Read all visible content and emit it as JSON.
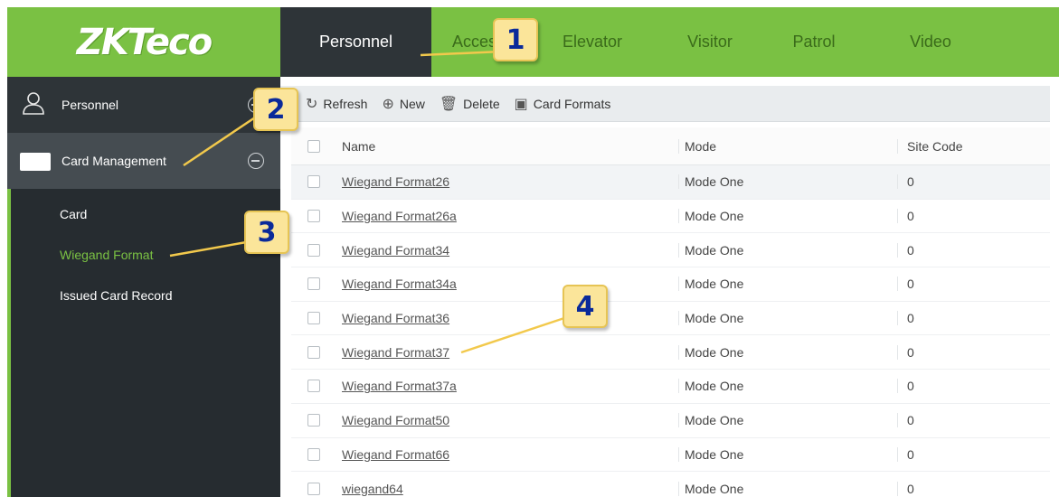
{
  "header": {
    "logo_text": "ZKTeco",
    "tabs": [
      {
        "label": "Personnel",
        "active": true
      },
      {
        "label": "Access"
      },
      {
        "label": "Elevator"
      },
      {
        "label": "Visitor"
      },
      {
        "label": "Patrol"
      },
      {
        "label": "Video"
      }
    ]
  },
  "sidebar": {
    "personnel_label": "Personnel",
    "card_management_label": "Card Management",
    "submenu": [
      {
        "label": "Card"
      },
      {
        "label": "Wiegand Format",
        "active": true
      },
      {
        "label": "Issued Card Record"
      }
    ]
  },
  "toolbar": {
    "refresh": "Refresh",
    "new": "New",
    "delete": "Delete",
    "card_formats": "Card Formats"
  },
  "table": {
    "columns": [
      "Name",
      "Mode",
      "Site Code"
    ],
    "rows": [
      {
        "name": "Wiegand Format26",
        "mode": "Mode One",
        "site": "0"
      },
      {
        "name": "Wiegand Format26a",
        "mode": "Mode One",
        "site": "0"
      },
      {
        "name": "Wiegand Format34",
        "mode": "Mode One",
        "site": "0"
      },
      {
        "name": "Wiegand Format34a",
        "mode": "Mode One",
        "site": "0"
      },
      {
        "name": "Wiegand Format36",
        "mode": "Mode One",
        "site": "0"
      },
      {
        "name": "Wiegand Format37",
        "mode": "Mode One",
        "site": "0"
      },
      {
        "name": "Wiegand Format37a",
        "mode": "Mode One",
        "site": "0"
      },
      {
        "name": "Wiegand Format50",
        "mode": "Mode One",
        "site": "0"
      },
      {
        "name": "Wiegand Format66",
        "mode": "Mode One",
        "site": "0"
      },
      {
        "name": "wiegand64",
        "mode": "Mode One",
        "site": "0"
      }
    ]
  },
  "callouts": [
    "1",
    "2",
    "3",
    "4"
  ],
  "colors": {
    "brand_green": "#7ac143",
    "dark": "#2e3438",
    "callout_fill": "#fbe59a",
    "callout_text": "#0a2a9a"
  }
}
